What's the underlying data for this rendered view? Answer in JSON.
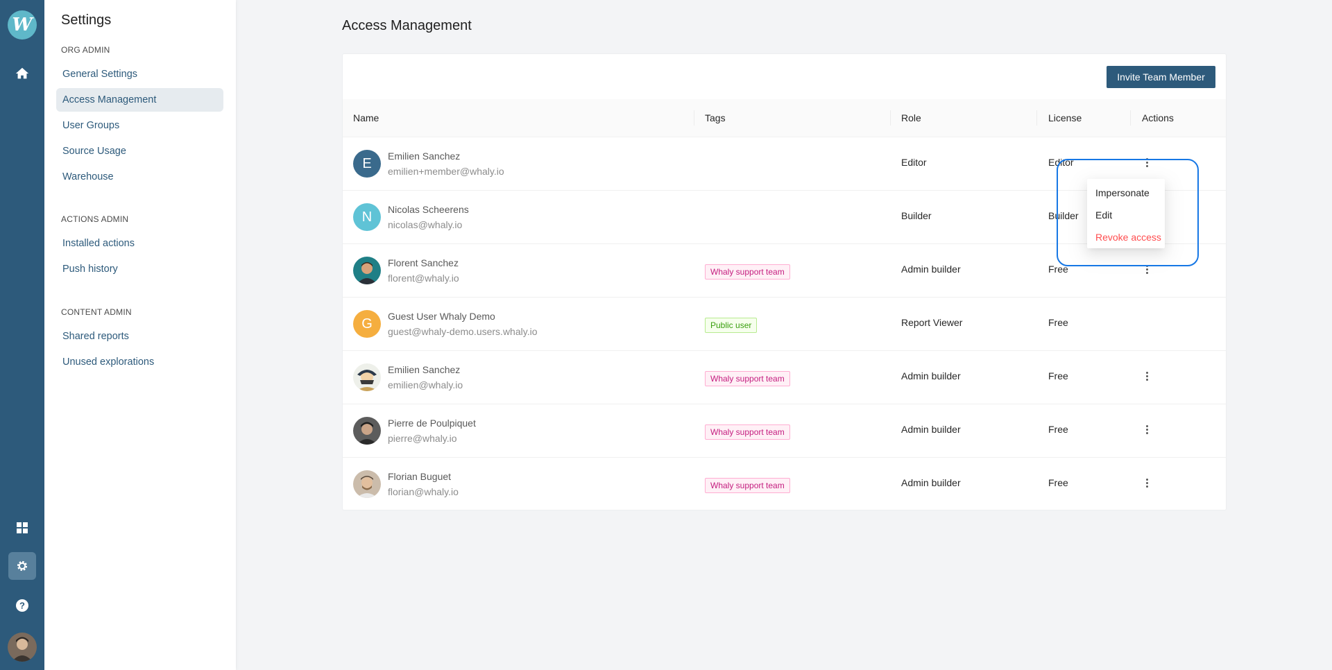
{
  "rail": {
    "logo_letter": "W",
    "icons": [
      "home-icon",
      "grid-icon",
      "gear-icon",
      "help-icon"
    ]
  },
  "sidebar": {
    "title": "Settings",
    "sections": [
      {
        "label": "ORG ADMIN",
        "items": [
          "General Settings",
          "Access Management",
          "User Groups",
          "Source Usage",
          "Warehouse"
        ]
      },
      {
        "label": "ACTIONS ADMIN",
        "items": [
          "Installed actions",
          "Push history"
        ]
      },
      {
        "label": "CONTENT ADMIN",
        "items": [
          "Shared reports",
          "Unused explorations"
        ]
      }
    ],
    "active_item": "Access Management"
  },
  "page": {
    "title": "Access Management",
    "invite_label": "Invite Team Member"
  },
  "table": {
    "headers": [
      "Name",
      "Tags",
      "Role",
      "License",
      "Actions"
    ],
    "rows": [
      {
        "name": "Emilien Sanchez",
        "email": "emilien+member@whaly.io",
        "avatar": "E",
        "avatar_color": "#3a6a8c",
        "tag": "",
        "role": "Editor",
        "license": "Editor"
      },
      {
        "name": "Nicolas Scheerens",
        "email": "nicolas@whaly.io",
        "avatar": "N",
        "avatar_color": "#5fc3d6",
        "tag": "",
        "role": "Builder",
        "license": "Builder"
      },
      {
        "name": "Florent Sanchez",
        "email": "florent@whaly.io",
        "avatar": "photo",
        "avatar_color": "#1f7f86",
        "tag": "Whaly support team",
        "role": "Admin builder",
        "license": "Free"
      },
      {
        "name": "Guest User Whaly Demo",
        "email": "guest@whaly-demo.users.whaly.io",
        "avatar": "G",
        "avatar_color": "#f5ae3f",
        "tag": "Public user",
        "role": "Report Viewer",
        "license": "Free"
      },
      {
        "name": "Emilien Sanchez",
        "email": "emilien@whaly.io",
        "avatar": "photo",
        "avatar_color": "#e8e2d2",
        "tag": "Whaly support team",
        "role": "Admin builder",
        "license": "Free"
      },
      {
        "name": "Pierre de Poulpiquet",
        "email": "pierre@whaly.io",
        "avatar": "photo",
        "avatar_color": "#6b6b6b",
        "tag": "Whaly support team",
        "role": "Admin builder",
        "license": "Free"
      },
      {
        "name": "Florian Buguet",
        "email": "florian@whaly.io",
        "avatar": "photo",
        "avatar_color": "#c9b8a6",
        "tag": "Whaly support team",
        "role": "Admin builder",
        "license": "Free"
      }
    ]
  },
  "dropdown": {
    "items": [
      "Impersonate",
      "Edit",
      "Revoke access"
    ]
  },
  "colors": {
    "brand": "#2d5a7b",
    "danger": "#ff4d4f",
    "highlight": "#1677e5"
  }
}
